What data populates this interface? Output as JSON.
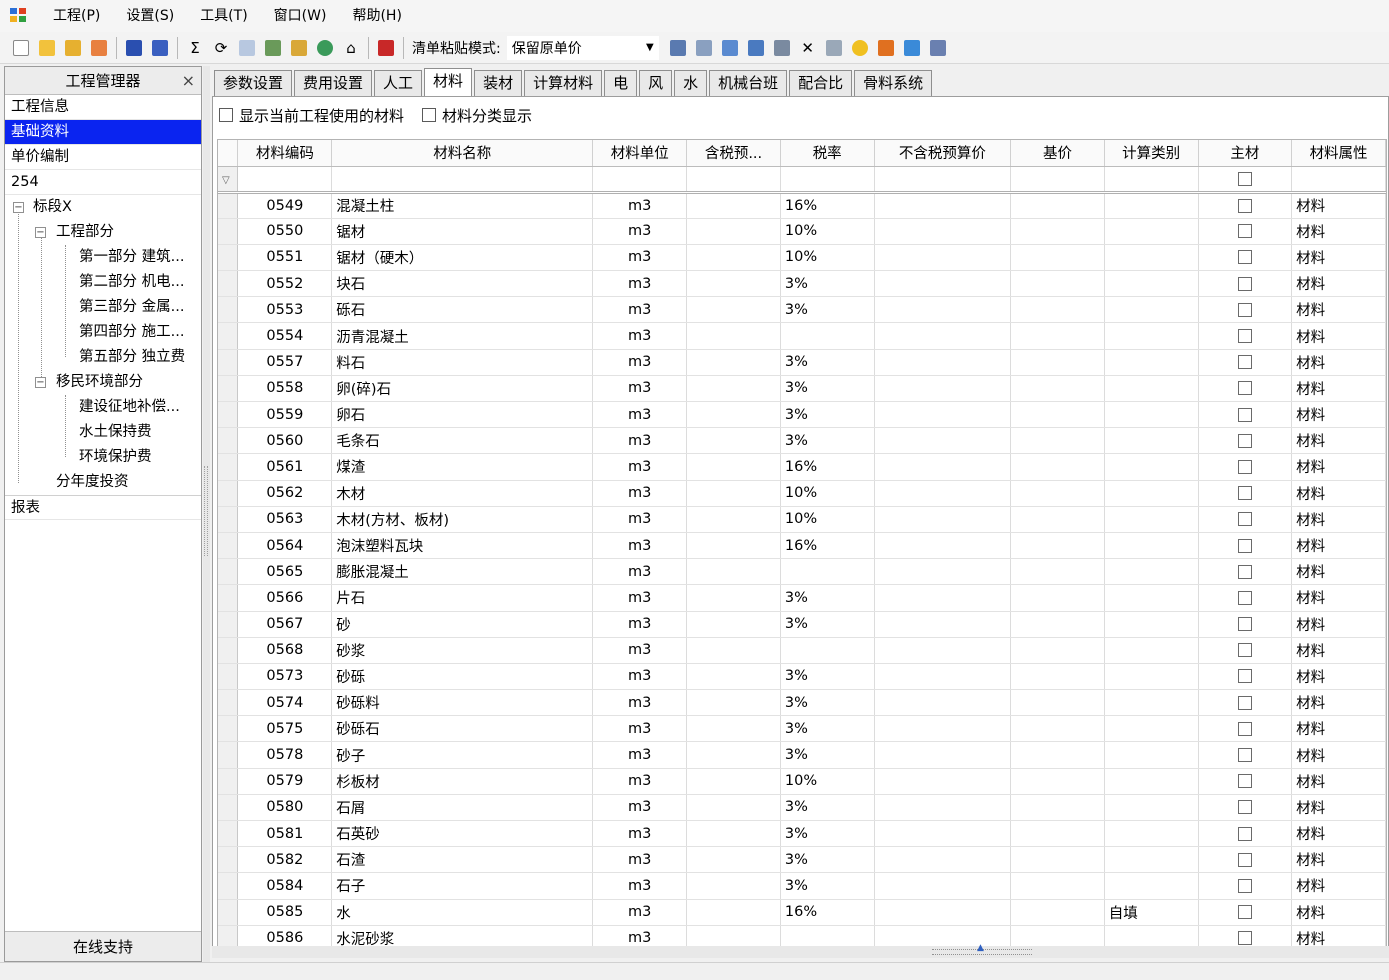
{
  "menu": [
    "工程(P)",
    "设置(S)",
    "工具(T)",
    "窗口(W)",
    "帮助(H)"
  ],
  "toolbar": {
    "paste_label": "清单粘贴模式:",
    "paste_value": "保留原单价"
  },
  "left_panel": {
    "title": "工程管理器",
    "close": "×",
    "items": [
      "工程信息",
      "基础资料",
      "单价编制",
      "254"
    ],
    "tree": {
      "root": "标段X",
      "engineering": "工程部分",
      "engineering_children": [
        "第一部分 建筑...",
        "第二部分 机电...",
        "第三部分 金属...",
        "第四部分 施工...",
        "第五部分 独立费"
      ],
      "resettlement": "移民环境部分",
      "resettlement_children": [
        "建设征地补偿...",
        "水土保持费",
        "环境保护费"
      ],
      "annual": "分年度投资"
    },
    "reports": "报表",
    "footer": "在线支持"
  },
  "tabs": [
    "参数设置",
    "费用设置",
    "人工",
    "材料",
    "装材",
    "计算材料",
    "电",
    "风",
    "水",
    "机械台班",
    "配合比",
    "骨料系统"
  ],
  "options": {
    "show_used": "显示当前工程使用的材料",
    "category": "材料分类显示"
  },
  "grid": {
    "columns": [
      "材料编码",
      "材料名称",
      "材料单位",
      "含税预...",
      "税率",
      "不含税预算价",
      "基价",
      "计算类别",
      "主材",
      "材料属性"
    ],
    "rows": [
      {
        "code": "0549",
        "name": "混凝土柱",
        "unit": "m3",
        "tax": "16%",
        "calc": "",
        "attr": "材料"
      },
      {
        "code": "0550",
        "name": "锯材",
        "unit": "m3",
        "tax": "10%",
        "calc": "",
        "attr": "材料"
      },
      {
        "code": "0551",
        "name": "锯材（硬木）",
        "unit": "m3",
        "tax": "10%",
        "calc": "",
        "attr": "材料"
      },
      {
        "code": "0552",
        "name": "块石",
        "unit": "m3",
        "tax": "3%",
        "calc": "",
        "attr": "材料"
      },
      {
        "code": "0553",
        "name": "砾石",
        "unit": "m3",
        "tax": "3%",
        "calc": "",
        "attr": "材料"
      },
      {
        "code": "0554",
        "name": "沥青混凝土",
        "unit": "m3",
        "tax": "",
        "calc": "",
        "attr": "材料"
      },
      {
        "code": "0557",
        "name": "料石",
        "unit": "m3",
        "tax": "3%",
        "calc": "",
        "attr": "材料"
      },
      {
        "code": "0558",
        "name": "卵(碎)石",
        "unit": "m3",
        "tax": "3%",
        "calc": "",
        "attr": "材料"
      },
      {
        "code": "0559",
        "name": "卵石",
        "unit": "m3",
        "tax": "3%",
        "calc": "",
        "attr": "材料"
      },
      {
        "code": "0560",
        "name": "毛条石",
        "unit": "m3",
        "tax": "3%",
        "calc": "",
        "attr": "材料"
      },
      {
        "code": "0561",
        "name": "煤渣",
        "unit": "m3",
        "tax": "16%",
        "calc": "",
        "attr": "材料"
      },
      {
        "code": "0562",
        "name": "木材",
        "unit": "m3",
        "tax": "10%",
        "calc": "",
        "attr": "材料"
      },
      {
        "code": "0563",
        "name": "木材(方材、板材)",
        "unit": "m3",
        "tax": "10%",
        "calc": "",
        "attr": "材料"
      },
      {
        "code": "0564",
        "name": "泡沫塑料瓦块",
        "unit": "m3",
        "tax": "16%",
        "calc": "",
        "attr": "材料"
      },
      {
        "code": "0565",
        "name": "膨胀混凝土",
        "unit": "m3",
        "tax": "",
        "calc": "",
        "attr": "材料"
      },
      {
        "code": "0566",
        "name": "片石",
        "unit": "m3",
        "tax": "3%",
        "calc": "",
        "attr": "材料"
      },
      {
        "code": "0567",
        "name": "砂",
        "unit": "m3",
        "tax": "3%",
        "calc": "",
        "attr": "材料"
      },
      {
        "code": "0568",
        "name": "砂浆",
        "unit": "m3",
        "tax": "",
        "calc": "",
        "attr": "材料"
      },
      {
        "code": "0573",
        "name": "砂砾",
        "unit": "m3",
        "tax": "3%",
        "calc": "",
        "attr": "材料"
      },
      {
        "code": "0574",
        "name": "砂砾料",
        "unit": "m3",
        "tax": "3%",
        "calc": "",
        "attr": "材料"
      },
      {
        "code": "0575",
        "name": "砂砾石",
        "unit": "m3",
        "tax": "3%",
        "calc": "",
        "attr": "材料"
      },
      {
        "code": "0578",
        "name": "砂子",
        "unit": "m3",
        "tax": "3%",
        "calc": "",
        "attr": "材料"
      },
      {
        "code": "0579",
        "name": "杉板材",
        "unit": "m3",
        "tax": "10%",
        "calc": "",
        "attr": "材料"
      },
      {
        "code": "0580",
        "name": "石屑",
        "unit": "m3",
        "tax": "3%",
        "calc": "",
        "attr": "材料"
      },
      {
        "code": "0581",
        "name": "石英砂",
        "unit": "m3",
        "tax": "3%",
        "calc": "",
        "attr": "材料"
      },
      {
        "code": "0582",
        "name": "石渣",
        "unit": "m3",
        "tax": "3%",
        "calc": "",
        "attr": "材料"
      },
      {
        "code": "0584",
        "name": "石子",
        "unit": "m3",
        "tax": "3%",
        "calc": "",
        "attr": "材料"
      },
      {
        "code": "0585",
        "name": "水",
        "unit": "m3",
        "tax": "16%",
        "calc": "自填",
        "attr": "材料"
      },
      {
        "code": "0586",
        "name": "水泥砂浆",
        "unit": "m3",
        "tax": "",
        "calc": "",
        "attr": "材料"
      }
    ]
  },
  "colors": {
    "selection": "#0a24f0",
    "accent": "#f0a020"
  }
}
